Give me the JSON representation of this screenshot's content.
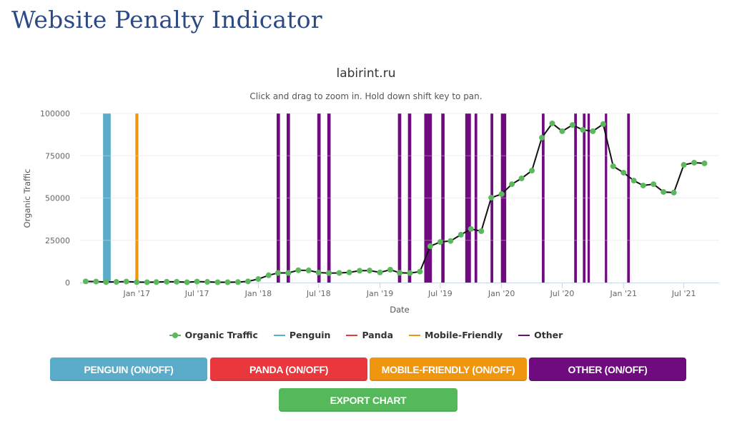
{
  "page": {
    "title": "Website Penalty Indicator"
  },
  "colors": {
    "organic": "#5cb85c",
    "organic_line": "#111111",
    "penguin": "#5bacc8",
    "panda": "#e8383d",
    "mobile": "#f0950e",
    "other": "#6f0b7f",
    "export": "#55b95c",
    "grid": "#e6e6e6"
  },
  "legend": [
    {
      "label": "Organic Traffic",
      "key": "organic",
      "marker": true
    },
    {
      "label": "Penguin",
      "key": "penguin",
      "marker": false
    },
    {
      "label": "Panda",
      "key": "panda",
      "marker": false
    },
    {
      "label": "Mobile-Friendly",
      "key": "mobile",
      "marker": false
    },
    {
      "label": "Other",
      "key": "other",
      "marker": false
    }
  ],
  "buttons": {
    "penguin": "PENGUIN (ON/OFF)",
    "panda": "PANDA (ON/OFF)",
    "mobile": "MOBILE-FRIENDLY (ON/OFF)",
    "other": "OTHER (ON/OFF)",
    "export": "EXPORT CHART"
  },
  "chart_data": {
    "type": "line",
    "title": "labirint.ru",
    "subtitle": "Click and drag to zoom in. Hold down shift key to pan.",
    "xlabel": "Date",
    "ylabel": "Organic Traffic",
    "ylim": [
      0,
      100000
    ],
    "yticks": [
      0,
      25000,
      50000,
      75000,
      100000
    ],
    "xticks": [
      "Jan '17",
      "Jul '17",
      "Jan '18",
      "Jul '18",
      "Jan '19",
      "Jul '19",
      "Jan '20",
      "Jul '20",
      "Jan '21",
      "Jul '21"
    ],
    "xticks_dates": [
      "2017-01",
      "2017-07",
      "2018-01",
      "2018-07",
      "2019-01",
      "2019-07",
      "2020-01",
      "2020-07",
      "2021-01",
      "2021-07"
    ],
    "xrange": [
      "2016-07-15",
      "2021-10-15"
    ],
    "grid": true,
    "legend_position": "bottom",
    "series": [
      {
        "name": "Organic Traffic",
        "x": [
          "2016-08",
          "2016-09",
          "2016-10",
          "2016-11",
          "2016-12",
          "2017-01",
          "2017-02",
          "2017-03",
          "2017-04",
          "2017-05",
          "2017-06",
          "2017-07",
          "2017-08",
          "2017-09",
          "2017-10",
          "2017-11",
          "2017-12",
          "2018-01",
          "2018-02",
          "2018-03",
          "2018-04",
          "2018-05",
          "2018-06",
          "2018-07",
          "2018-08",
          "2018-09",
          "2018-10",
          "2018-11",
          "2018-12",
          "2019-01",
          "2019-02",
          "2019-03",
          "2019-04",
          "2019-05",
          "2019-06",
          "2019-07",
          "2019-08",
          "2019-09",
          "2019-10",
          "2019-11",
          "2019-12",
          "2020-01",
          "2020-02",
          "2020-03",
          "2020-04",
          "2020-05",
          "2020-06",
          "2020-07",
          "2020-08",
          "2020-09",
          "2020-10",
          "2020-11",
          "2020-12",
          "2021-01",
          "2021-02",
          "2021-03",
          "2021-04",
          "2021-05",
          "2021-06",
          "2021-07",
          "2021-08",
          "2021-09"
        ],
        "values": [
          700,
          600,
          300,
          400,
          600,
          300,
          200,
          300,
          500,
          500,
          200,
          600,
          400,
          200,
          200,
          300,
          700,
          2100,
          4300,
          5700,
          5700,
          7300,
          7200,
          5900,
          5600,
          5700,
          6000,
          7000,
          7100,
          6000,
          7600,
          5800,
          5600,
          6500,
          21500,
          24000,
          24600,
          28300,
          31700,
          30400,
          50200,
          52300,
          58200,
          61600,
          66200,
          85700,
          94100,
          89500,
          93200,
          90300,
          89500,
          93700,
          68800,
          65000,
          60300,
          57400,
          58200,
          53600,
          53200,
          69600,
          70900,
          70500
        ]
      }
    ],
    "events": {
      "penguin": [
        {
          "start": "2016-09-22",
          "end": "2016-10-15"
        }
      ],
      "panda": [],
      "mobile": [
        {
          "start": "2016-12-28",
          "end": "2017-01-06"
        }
      ],
      "other": [
        {
          "start": "2018-02-25",
          "end": "2018-03-07"
        },
        {
          "start": "2018-03-27",
          "end": "2018-04-06"
        },
        {
          "start": "2018-06-27",
          "end": "2018-07-07"
        },
        {
          "start": "2018-07-27",
          "end": "2018-08-06"
        },
        {
          "start": "2019-02-24",
          "end": "2019-03-06"
        },
        {
          "start": "2019-03-26",
          "end": "2019-04-05"
        },
        {
          "start": "2019-05-14",
          "end": "2019-06-06"
        },
        {
          "start": "2019-07-04",
          "end": "2019-07-14"
        },
        {
          "start": "2019-09-14",
          "end": "2019-10-01"
        },
        {
          "start": "2019-10-12",
          "end": "2019-10-20"
        },
        {
          "start": "2019-11-29",
          "end": "2019-12-07"
        },
        {
          "start": "2019-12-30",
          "end": "2020-01-15"
        },
        {
          "start": "2020-05-01",
          "end": "2020-05-09"
        },
        {
          "start": "2020-08-06",
          "end": "2020-08-14"
        },
        {
          "start": "2020-09-01",
          "end": "2020-09-09"
        },
        {
          "start": "2020-09-15",
          "end": "2020-09-22"
        },
        {
          "start": "2020-11-06",
          "end": "2020-11-13"
        },
        {
          "start": "2021-01-12",
          "end": "2021-01-20"
        }
      ]
    }
  }
}
